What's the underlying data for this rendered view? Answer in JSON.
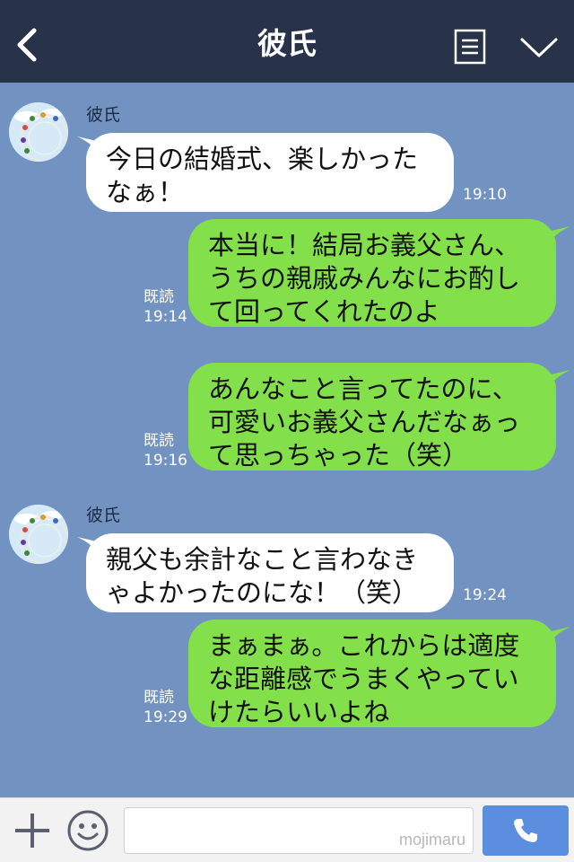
{
  "header": {
    "title": "彼氏"
  },
  "messages": [
    {
      "sender": "彼氏",
      "text": "今日の結婚式、楽しかったなぁ！",
      "time": "19:10"
    },
    {
      "read": "既読",
      "text": "本当に！結局お義父さん、うちの親戚みんなにお酌して回ってくれたのよ",
      "time": "19:14"
    },
    {
      "read": "既読",
      "text": "あんなこと言ってたのに、可愛いお義父さんだなぁって思っちゃった（笑）",
      "time": "19:16"
    },
    {
      "sender": "彼氏",
      "text": "親父も余計なこと言わなきゃよかったのにな！（笑）",
      "time": "19:24"
    },
    {
      "read": "既読",
      "text": "まぁまぁ。これからは適度な距離感でうまくやっていけたらいいよね",
      "time": "19:29"
    }
  ],
  "input": {
    "watermark": "mojimaru"
  },
  "icons": {
    "back": "chevron-left-icon",
    "menu": "document-list-icon",
    "more": "chevron-down-icon",
    "add": "plus-icon",
    "sticker": "smile-icon",
    "call": "phone-icon"
  },
  "colors": {
    "header": "#283249",
    "background": "#7293c1",
    "incoming_bubble": "#ffffff",
    "outgoing_bubble": "#84e04a",
    "call_button": "#5c8ee0"
  }
}
